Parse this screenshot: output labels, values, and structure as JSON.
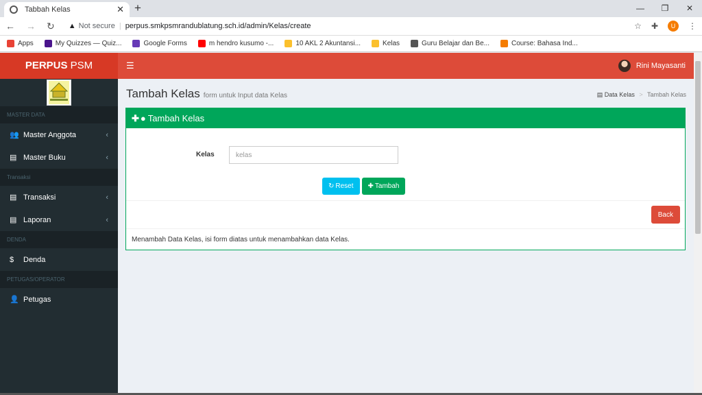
{
  "browser": {
    "tab_title": "Tabbah Kelas",
    "url_warning": "Not secure",
    "url": "perpus.smkpsmrandublatung.sch.id/admin/Kelas/create",
    "profile": "U"
  },
  "bookmarks": [
    {
      "label": "Apps",
      "color": "#e94235"
    },
    {
      "label": "My Quizzes — Quiz...",
      "color": "#4a148c"
    },
    {
      "label": "Google Forms",
      "color": "#673ab7"
    },
    {
      "label": "m hendro kusumo -...",
      "color": "#ff0000"
    },
    {
      "label": "10 AKL 2 Akuntansi...",
      "color": "#fbc02d"
    },
    {
      "label": "Kelas",
      "color": "#fbc02d"
    },
    {
      "label": "Guru Belajar dan Be...",
      "color": "#555555"
    },
    {
      "label": "Course: Bahasa Ind...",
      "color": "#f57c00"
    }
  ],
  "app": {
    "logo_bold": "PERPUS",
    "logo_rest": " PSM",
    "user": "Rini Mayasanti"
  },
  "sidebar": [
    {
      "type": "header",
      "label": "MASTER DATA"
    },
    {
      "type": "item",
      "icon": "users-icon",
      "glyph": "👥",
      "label": "Master Anggota",
      "chev": "‹"
    },
    {
      "type": "item",
      "icon": "book-icon",
      "glyph": "▤",
      "label": "Master Buku",
      "chev": "‹"
    },
    {
      "type": "header",
      "label": "Transaksi"
    },
    {
      "type": "item",
      "icon": "book-icon",
      "glyph": "▤",
      "label": "Transaksi",
      "chev": "‹"
    },
    {
      "type": "item",
      "icon": "book-icon",
      "glyph": "▤",
      "label": "Laporan",
      "chev": "‹"
    },
    {
      "type": "header",
      "label": "DENDA"
    },
    {
      "type": "item",
      "icon": "dollar-icon",
      "glyph": "$",
      "label": "Denda",
      "chev": ""
    },
    {
      "type": "header",
      "label": "PETUGAS/OPERATOR"
    },
    {
      "type": "item",
      "icon": "user-plus-icon",
      "glyph": "👤",
      "label": "Petugas",
      "chev": ""
    }
  ],
  "page": {
    "title": "Tambah Kelas",
    "subtitle": "form untuk Input data Kelas",
    "crumb1": "Data Kelas",
    "crumb2": "Tambah Kelas"
  },
  "form": {
    "header": "Tambah Kelas",
    "label": "Kelas",
    "placeholder": "kelas",
    "reset": "Reset",
    "add": "Tambah",
    "back": "Back",
    "footer": "Menambah Data Kelas, isi form diatas untuk menambahkan data Kelas."
  }
}
